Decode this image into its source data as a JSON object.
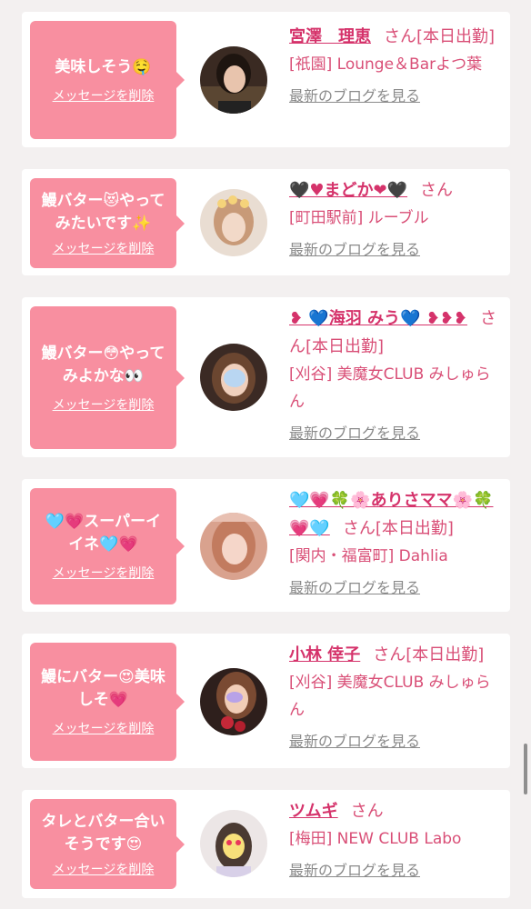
{
  "colors": {
    "background": "#f3f0f0",
    "bubble": "#f88fa0",
    "name": "#d5336b",
    "text_pink": "#d94f77",
    "link_gray": "#8a8a8a"
  },
  "delete_label": "メッセージを削除",
  "blog_label": "最新のブログを見る",
  "honorific": "さん",
  "cards": [
    {
      "message": "美味しそう🤤",
      "name": "宮澤　理恵",
      "status": "[本日出勤]",
      "shop": "[祇園] Lounge＆Barよつ葉"
    },
    {
      "message": "鰻バター😻やって\nみたいです✨",
      "name": "🖤♥まどか❤🖤",
      "status": "",
      "shop": "[町田駅前] ルーブル"
    },
    {
      "message": "鰻バター😳やって\nみよかな👀",
      "name": "❥ 💙海羽 みう💙 ❥❥❥",
      "status": "[本日出勤]",
      "shop": "[刈谷] 美魔女CLUB みしゅらん"
    },
    {
      "message": "🩵💗スーパーイ\nイネ🩵💗",
      "name": "🩵💗🍀🌸ありさママ🌸🍀💗🩵",
      "status": "[本日出勤]",
      "shop": "[関内・福富町] Dahlia"
    },
    {
      "message": "鰻にバター😍美味\nしそ💗",
      "name": "小林 倖子",
      "status": "[本日出勤]",
      "shop": "[刈谷] 美魔女CLUB みしゅらん"
    },
    {
      "message": "タレとバター合い\nそうです😍",
      "name": "ツムギ",
      "status": "",
      "shop": "[梅田] NEW CLUB Labo"
    }
  ]
}
